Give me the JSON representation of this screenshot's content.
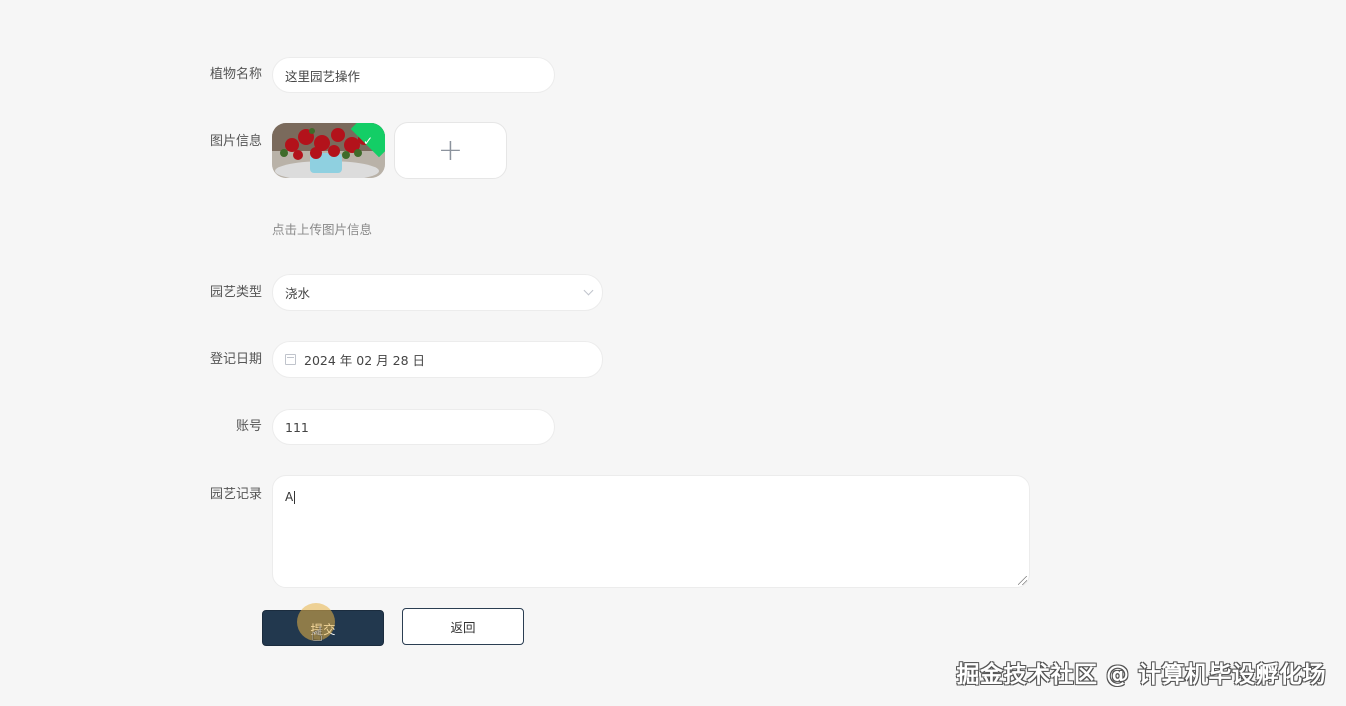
{
  "form": {
    "plant_name": {
      "label": "植物名称",
      "value": "这里园艺操作"
    },
    "image": {
      "label": "图片信息",
      "upload_hint": "点击上传图片信息",
      "upload_icon": "plus-icon",
      "success_icon": "check-icon",
      "plus_glyph": "+",
      "check_glyph": "✓"
    },
    "type": {
      "label": "园艺类型",
      "value": "浇水",
      "icon": "chevron-down-icon"
    },
    "date": {
      "label": "登记日期",
      "value": "2024 年 02 月 28 日",
      "icon": "calendar-icon"
    },
    "account": {
      "label": "账号",
      "value": "111"
    },
    "record": {
      "label": "园艺记录",
      "value": "A"
    }
  },
  "buttons": {
    "submit_label": "提交",
    "back_label": "返回"
  },
  "colors": {
    "submit_bg": "#22384e",
    "success_corner": "#13ce66",
    "page_bg": "#f6f6f6"
  },
  "watermark": "掘金技术社区 @ 计算机毕设孵化场"
}
